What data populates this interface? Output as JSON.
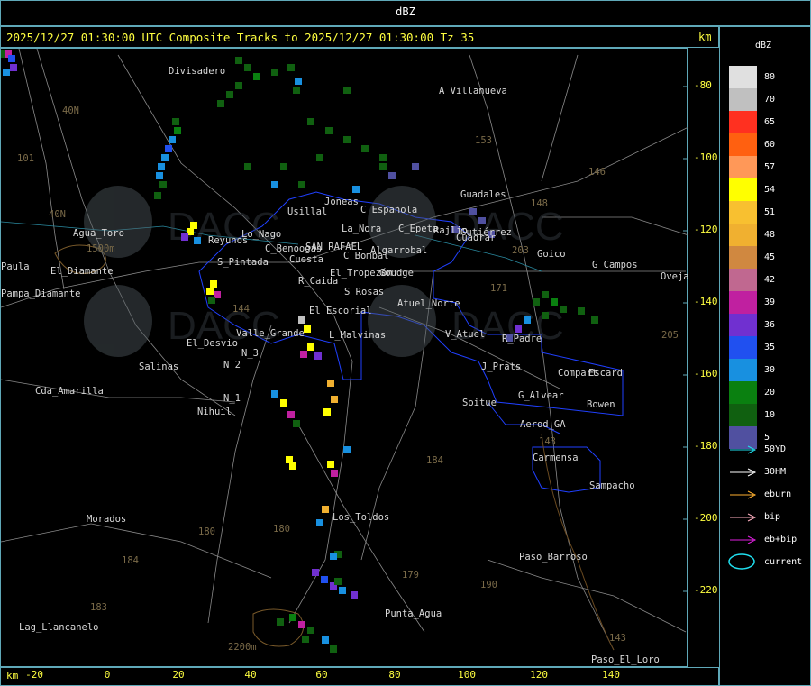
{
  "product_label": "dBZ",
  "title": "2025/12/27 01:30:00 UTC Composite Tracks to 2025/12/27 01:30:00 Tz 35",
  "km_label": "km",
  "x_ticks": [
    "-20",
    "0",
    "20",
    "40",
    "60",
    "80",
    "100",
    "120",
    "140"
  ],
  "y_ticks": [
    "-80",
    "-100",
    "-120",
    "-140",
    "-160",
    "-180",
    "-200",
    "-220"
  ],
  "legend": {
    "title": "dBZ",
    "levels": [
      {
        "label": "80",
        "color": "#e0e0e0"
      },
      {
        "label": "70",
        "color": "#c0c0c0"
      },
      {
        "label": "65",
        "color": "#ff3020"
      },
      {
        "label": "60",
        "color": "#ff6010"
      },
      {
        "label": "57",
        "color": "#ff9858"
      },
      {
        "label": "54",
        "color": "#ffff00"
      },
      {
        "label": "51",
        "color": "#f8c030"
      },
      {
        "label": "48",
        "color": "#f0b030"
      },
      {
        "label": "45",
        "color": "#d08840"
      },
      {
        "label": "42",
        "color": "#c06890"
      },
      {
        "label": "39",
        "color": "#c020a0"
      },
      {
        "label": "36",
        "color": "#7030d0"
      },
      {
        "label": "35",
        "color": "#2050f0"
      },
      {
        "label": "30",
        "color": "#1890e0"
      },
      {
        "label": "20",
        "color": "#0a8010"
      },
      {
        "label": "10",
        "color": "#106010"
      },
      {
        "label": "5",
        "color": "#5050a0"
      }
    ],
    "tracks": [
      {
        "label": "50YD",
        "color": "#20e0f0"
      },
      {
        "label": "30HM",
        "color": "#ffffff"
      },
      {
        "label": "eburn",
        "color": "#ffb030"
      },
      {
        "label": "bip",
        "color": "#ffb0c0"
      },
      {
        "label": "eb+bip",
        "color": "#e020e0"
      }
    ],
    "current_label": "current",
    "current_color": "#20e0f0"
  },
  "place_names": [
    "Divisadero",
    "A_Villanueva",
    "Usillal",
    "Joneas",
    "C_Española",
    "C_Epeta",
    "Cuadrar",
    "La_Nora",
    "Guadales",
    "Reyunos",
    "Lo_Nago",
    "C_Benoogas",
    "SAN_RAFAEL",
    "C_Bombal",
    "Algarrobal",
    "Rajlin",
    "Gutiérrez",
    "Goudge",
    "Goico",
    "G_Campos",
    "Ovejas",
    "S_Pintada",
    "Cuesta",
    "El_Tropezón",
    "R_Caida",
    "S_Rosas",
    "Atuel_Norte",
    "Agua_Toro",
    "El_Diamante",
    "Paula",
    "Pampa_Diamante",
    "El_Escorial",
    "L_Malvinas",
    "V_Atuel",
    "R_Padre",
    "El_Desvio",
    "Valle_Grande",
    "N_3",
    "N_2",
    "Salinas",
    "J_Prats",
    "Compart",
    "Escard",
    "Cda_Amarilla",
    "N_1",
    "Soitue",
    "G_Alvear",
    "Bowen",
    "Nihuil",
    "Carmensa",
    "Sampacho",
    "Aerod_GA",
    "Morados",
    "Los_Toldos",
    "Paso_Barroso",
    "Punta_Agua",
    "Lag_Llancanelo",
    "Paso_El_Loro"
  ],
  "route_numbers": [
    "40N",
    "40N",
    "101",
    "153",
    "146",
    "148",
    "203",
    "171",
    "143",
    "205",
    "184",
    "180",
    "184",
    "183",
    "179",
    "190",
    "143",
    "144",
    "1500m",
    "2200m",
    "180"
  ]
}
